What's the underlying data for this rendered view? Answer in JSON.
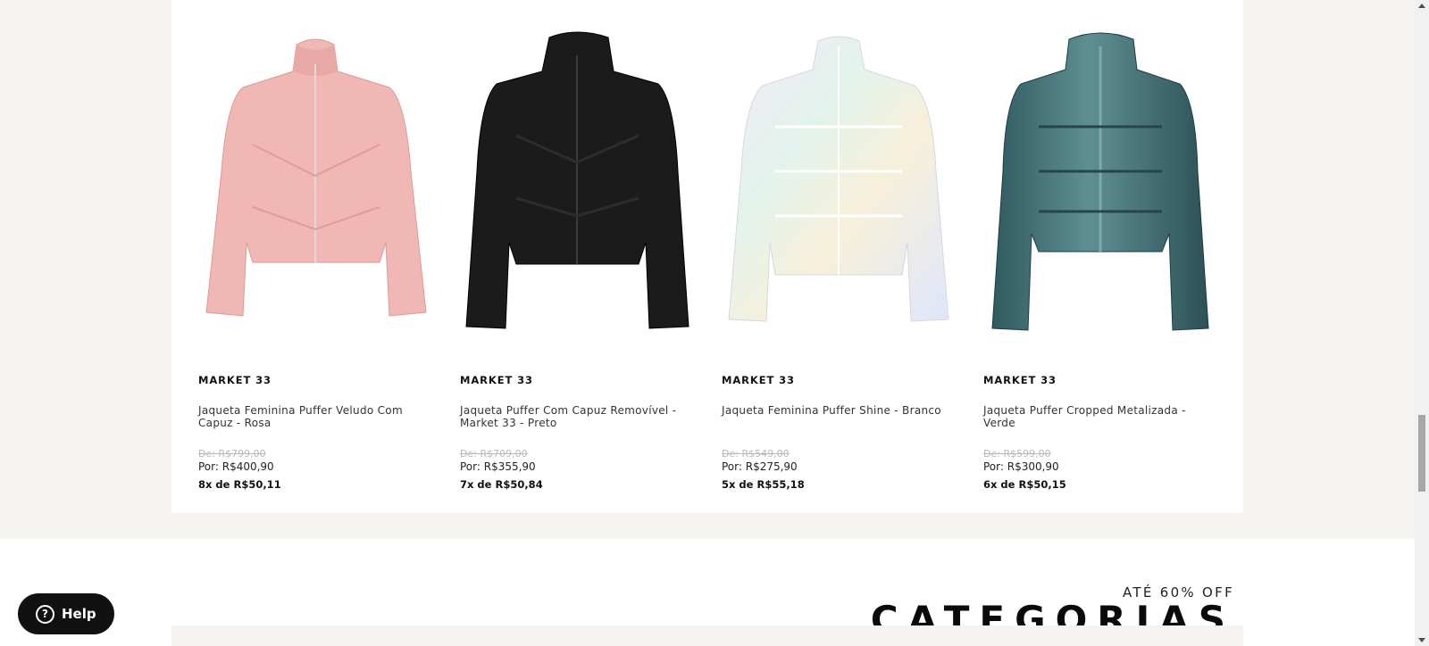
{
  "products": [
    {
      "brand": "MARKET 33",
      "name": "Jaqueta Feminina Puffer Veludo Com Capuz - Rosa",
      "old_price": "De: R$799,00",
      "new_price": "Por: R$400,90",
      "installments": "8x de R$50,11",
      "image": "pink-velvet-puffer-jacket",
      "color": "#f0b7b4"
    },
    {
      "brand": "MARKET 33",
      "name": "Jaqueta Puffer Com Capuz Removível - Market 33 - Preto",
      "old_price": "De: R$709,00",
      "new_price": "Por: R$355,90",
      "installments": "7x de R$50,84",
      "image": "black-puffer-jacket",
      "color": "#1b1b1b"
    },
    {
      "brand": "MARKET 33",
      "name": "Jaqueta Feminina Puffer Shine - Branco",
      "old_price": "De: R$549,00",
      "new_price": "Por: R$275,90",
      "installments": "5x de R$55,18",
      "image": "iridescent-white-puffer-jacket",
      "color": "#eef0f6"
    },
    {
      "brand": "MARKET 33",
      "name": "Jaqueta Puffer Cropped Metalizada - Verde",
      "old_price": "De: R$599,00",
      "new_price": "Por: R$300,90",
      "installments": "6x de R$50,15",
      "image": "metallic-green-puffer-jacket",
      "color": "#3f6d73"
    }
  ],
  "categories": {
    "subtitle": "ATÉ 60% OFF",
    "title": "CATEGORIAS"
  },
  "help": {
    "label": "Help",
    "icon": "question-circle-icon"
  }
}
